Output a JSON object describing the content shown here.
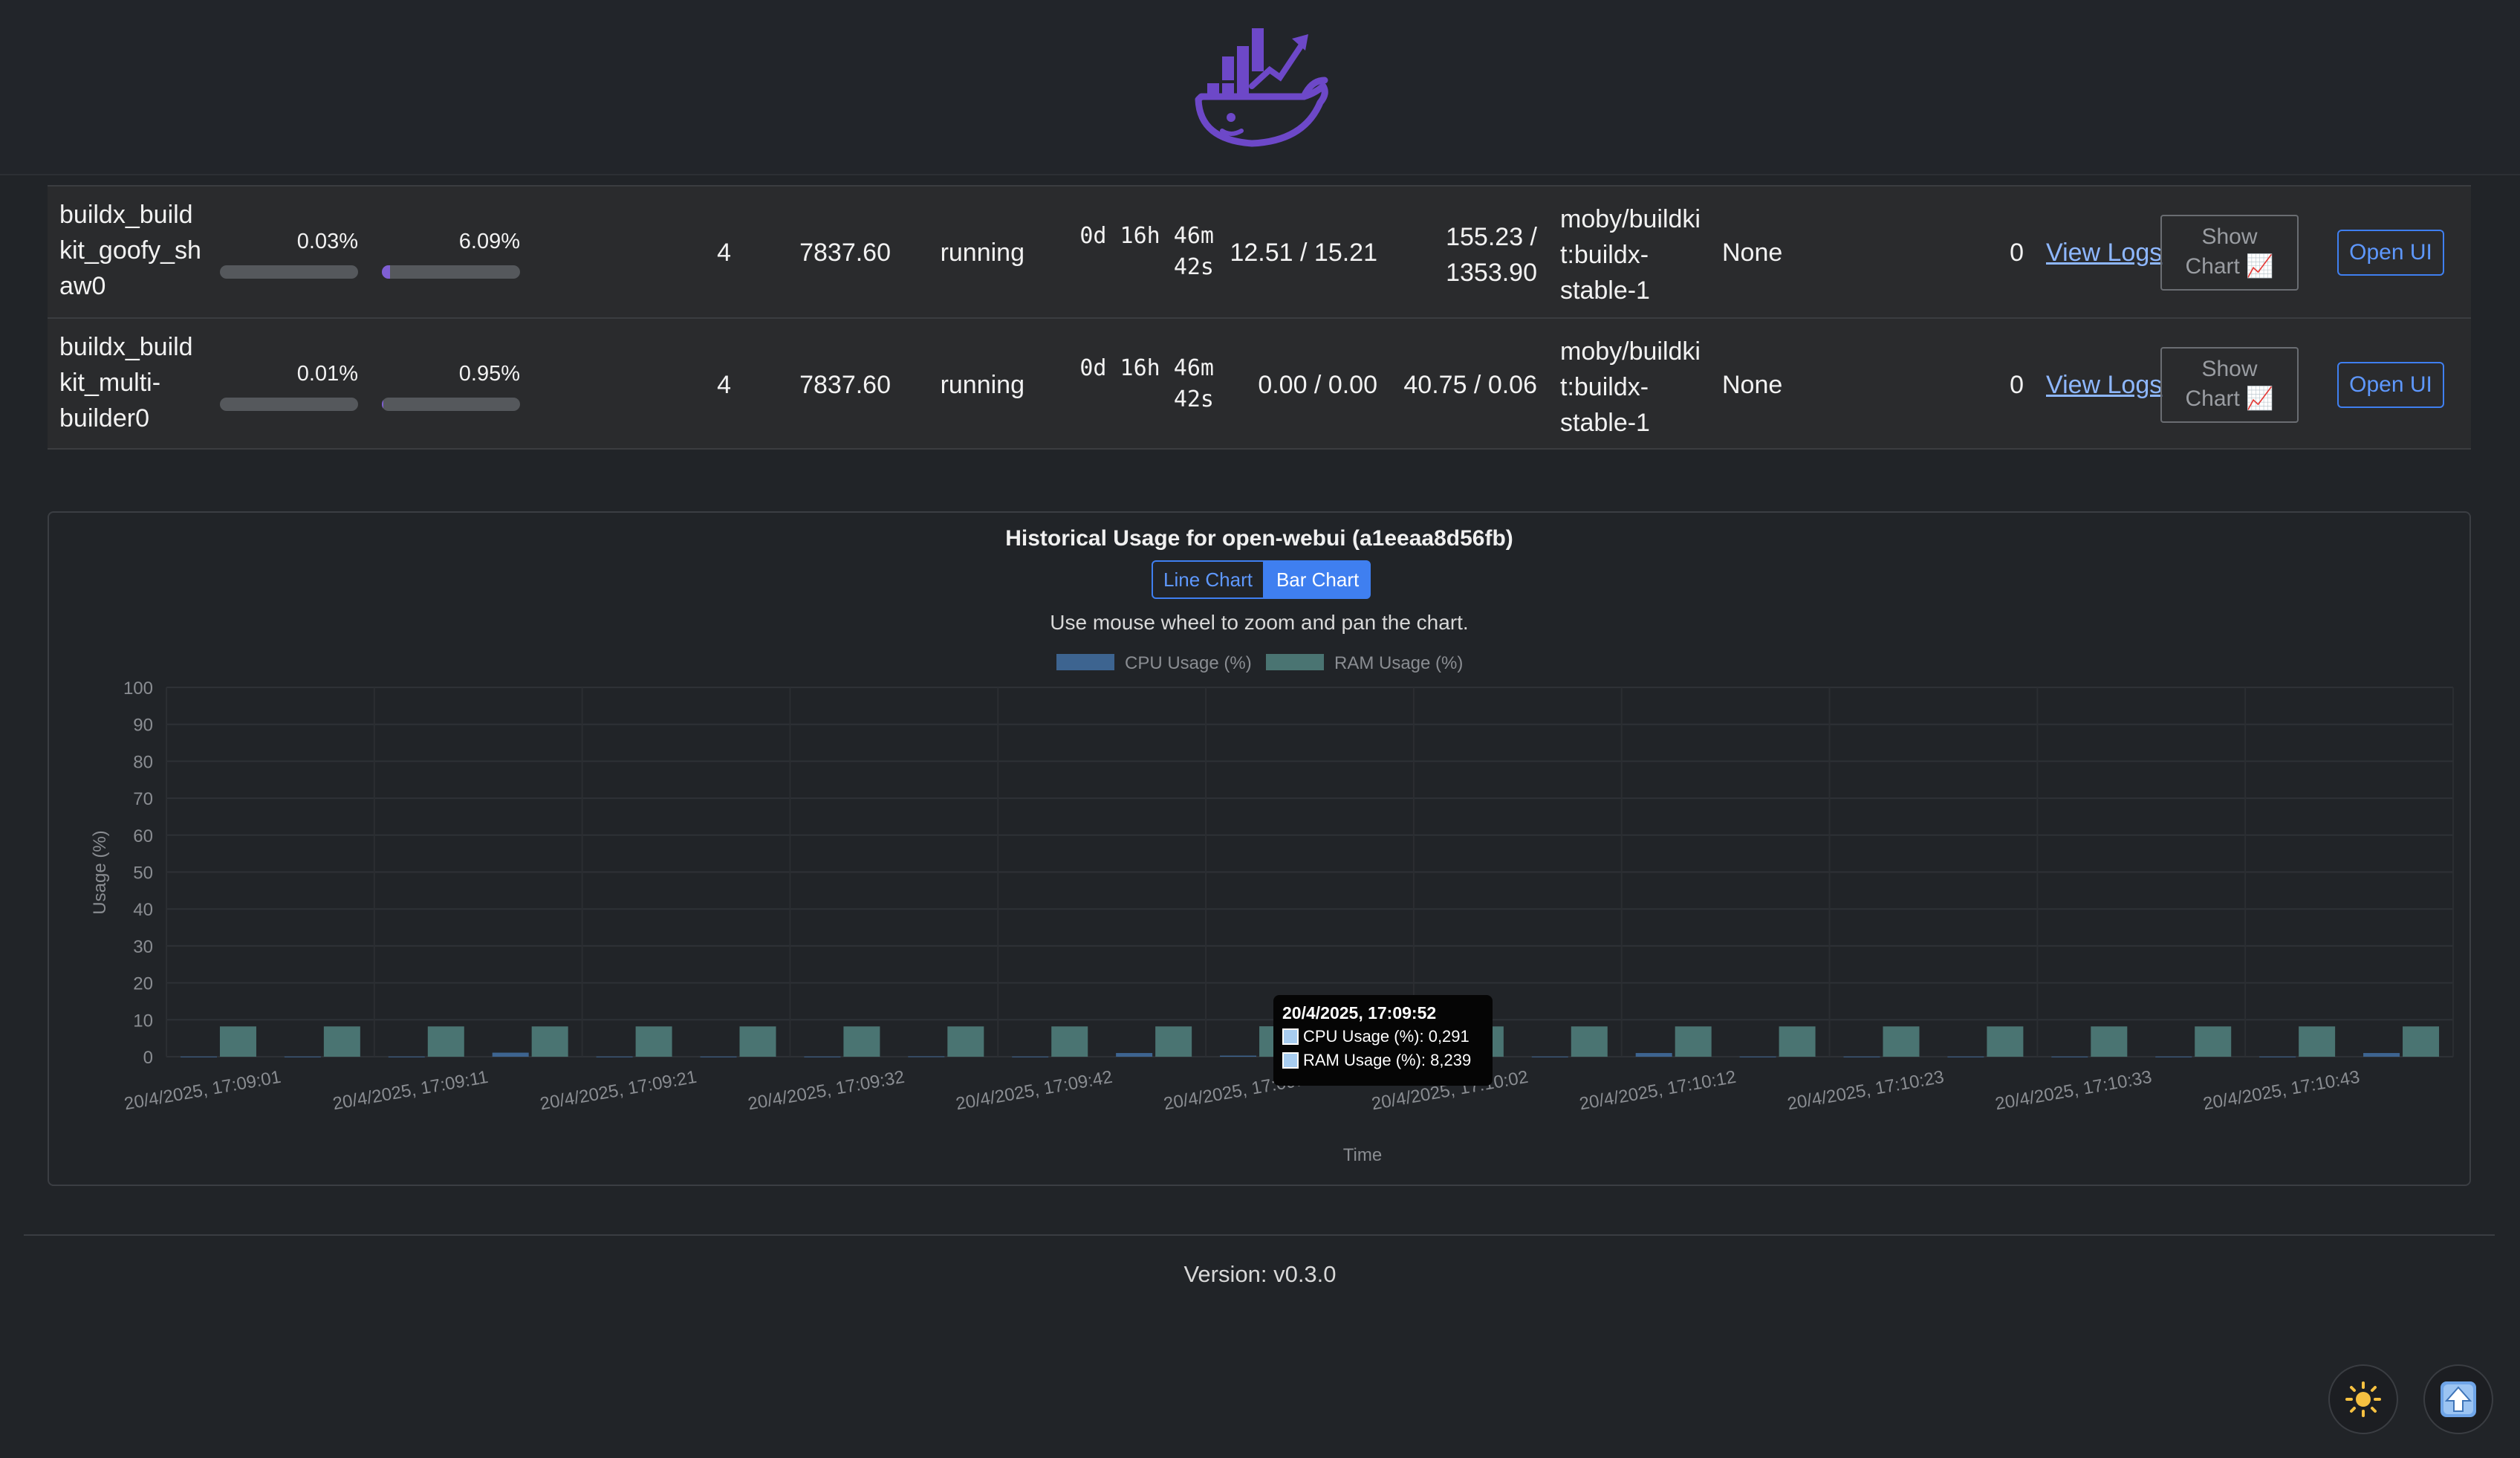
{
  "header": {
    "logo_icon": "docker-whale-chart-logo",
    "logo_color": "#6d48c8"
  },
  "containers": [
    {
      "name": "buildx_buildkit_goofy_shaw0",
      "name_lines": [
        "buildx_build",
        "kit_goofy_sh",
        "aw0"
      ],
      "cpu_pct": "0.03%",
      "cpu_fill": 0.0003,
      "ram_pct": "6.09%",
      "ram_fill": 0.0609,
      "procs": "4",
      "mem_limit": "7837.60",
      "status": "running",
      "uptime_lines": [
        "0d 16h 46m",
        "42s"
      ],
      "net_io": "12.51 / 15.21",
      "block_io_lines": [
        "155.23 /",
        "1353.90"
      ],
      "image_lines": [
        "moby/buildki",
        "t:buildx-",
        "stable-1"
      ],
      "ports": "None",
      "restarts": "0",
      "logs_label": "View Logs",
      "chart_label_lines": [
        "Show",
        "Chart 📈"
      ],
      "open_ui_label": "Open UI"
    },
    {
      "name": "buildx_buildkit_multi-builder0",
      "name_lines": [
        "buildx_build",
        "kit_multi-",
        "builder0"
      ],
      "cpu_pct": "0.01%",
      "cpu_fill": 0.0001,
      "ram_pct": "0.95%",
      "ram_fill": 0.0095,
      "procs": "4",
      "mem_limit": "7837.60",
      "status": "running",
      "uptime_lines": [
        "0d 16h 46m",
        "42s"
      ],
      "net_io": "0.00 / 0.00",
      "block_io_lines": [
        "40.75 / 0.06"
      ],
      "image_lines": [
        "moby/buildki",
        "t:buildx-",
        "stable-1"
      ],
      "ports": "None",
      "restarts": "0",
      "logs_label": "View Logs",
      "chart_label_lines": [
        "Show",
        "Chart 📈"
      ],
      "open_ui_label": "Open UI"
    }
  ],
  "chart_panel": {
    "title": "Historical Usage for open-webui (a1eeaa8d56fb)",
    "toggle": {
      "line_label": "Line Chart",
      "bar_label": "Bar Chart",
      "active": "bar"
    },
    "hint": "Use mouse wheel to zoom and pan the chart.",
    "tooltip": {
      "title": "20/4/2025, 17:09:52",
      "cpu_line": "CPU Usage (%): 0,291",
      "ram_line": "RAM Usage (%): 8,239"
    }
  },
  "chart_data": {
    "type": "bar",
    "xlabel": "Time",
    "ylabel": "Usage (%)",
    "ylim": [
      0,
      100
    ],
    "yticks": [
      0,
      10,
      20,
      30,
      40,
      50,
      60,
      70,
      80,
      90,
      100
    ],
    "x_tick_labels": [
      "20/4/2025, 17:09:01",
      "20/4/2025, 17:09:11",
      "20/4/2025, 17:09:21",
      "20/4/2025, 17:09:32",
      "20/4/2025, 17:09:42",
      "20/4/2025, 17:09:52",
      "20/4/2025, 17:10:02",
      "20/4/2025, 17:10:12",
      "20/4/2025, 17:10:23",
      "20/4/2025, 17:10:33",
      "20/4/2025, 17:10:43"
    ],
    "grid": true,
    "legend_position": "top",
    "series": [
      {
        "name": "CPU Usage (%)",
        "color": "#3d6490",
        "values": [
          0.05,
          0.05,
          0.05,
          1.1,
          0.05,
          0.05,
          0.05,
          0.1,
          0.05,
          1.0,
          0.291,
          0.05,
          0.05,
          0.05,
          1.0,
          0.05,
          0.05,
          0.05,
          0.05,
          0.05,
          0.05,
          1.0
        ]
      },
      {
        "name": "RAM Usage (%)",
        "color": "#4a7472",
        "values": [
          8.2,
          8.2,
          8.2,
          8.2,
          8.2,
          8.2,
          8.2,
          8.2,
          8.2,
          8.2,
          8.239,
          8.2,
          8.2,
          8.2,
          8.2,
          8.2,
          8.2,
          8.2,
          8.2,
          8.2,
          8.2,
          8.2
        ]
      }
    ]
  },
  "footer": {
    "version": "Version: v0.3.0"
  },
  "buttons": {
    "theme_icon": "sun-icon",
    "scroll_top_icon": "arrow-up-icon"
  }
}
